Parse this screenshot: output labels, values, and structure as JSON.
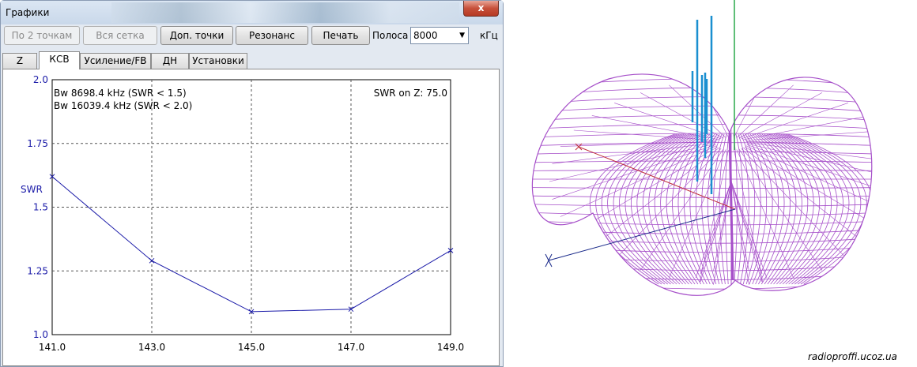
{
  "window": {
    "title": "Графики",
    "close_glyph": "x"
  },
  "toolbar": {
    "two_points": "По 2 точкам",
    "full_grid": "Вся сетка",
    "extra_points": "Доп. точки",
    "resonance": "Резонанс",
    "print": "Печать",
    "band_label": "Полоса",
    "band_value": "8000",
    "unit": "кГц"
  },
  "tabs": [
    "Z",
    "КСВ",
    "Усиление/FB",
    "ДН",
    "Установки"
  ],
  "plot": {
    "bw1": "Bw 8698.4 kHz (SWR < 1.5)",
    "bw2": "Bw 16039.4 kHz (SWR < 2.0)",
    "swr_on_z": "SWR on Z: 75.0",
    "ylabel": "SWR"
  },
  "chart_data": {
    "type": "line",
    "x": [
      141.0,
      143.0,
      145.0,
      147.0,
      149.0
    ],
    "values": [
      1.62,
      1.29,
      1.09,
      1.1,
      1.33
    ],
    "xlim": [
      141.0,
      149.0
    ],
    "ylim": [
      1.0,
      2.0
    ],
    "xticks": [
      "141.0",
      "143.0",
      "145.0",
      "147.0",
      "149.0"
    ],
    "yticks": [
      "1.0",
      "1.25",
      "1.5",
      "1.75",
      "2.0"
    ],
    "ylabel": "SWR",
    "grid": true,
    "line_color": "#1a1aa8"
  },
  "pattern_3d": {
    "mesh_color": "#a64fc9",
    "x_axis_color": "#c0303c",
    "y_axis_color": "#1a2a8a",
    "antenna_color": "#1a8fd0",
    "z_axis_color": "#2aa84a"
  },
  "watermark": "radioproffi.ucoz.ua"
}
